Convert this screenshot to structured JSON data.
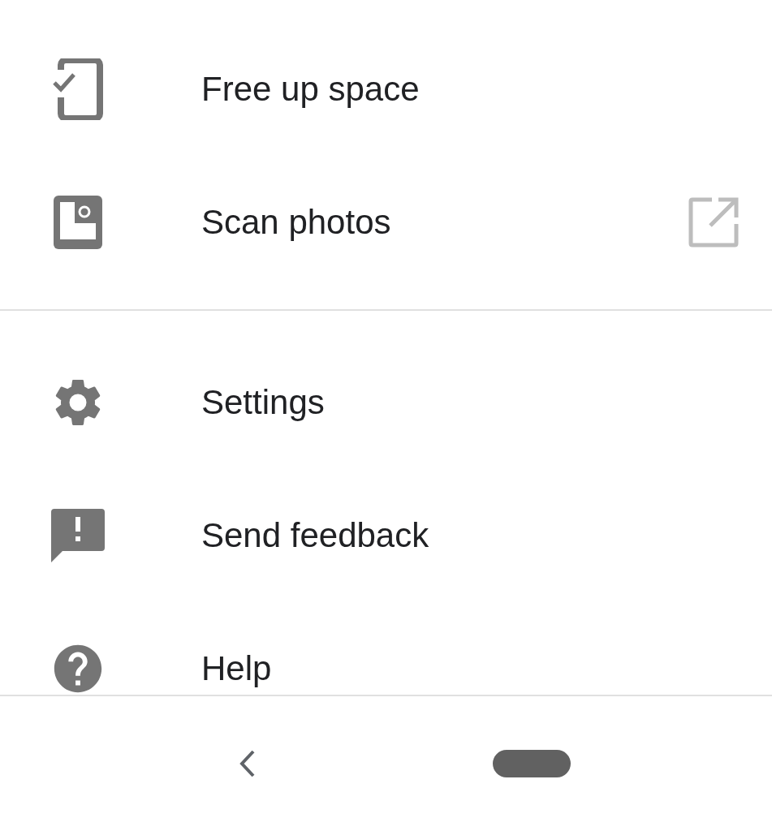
{
  "menu": {
    "sections": [
      {
        "items": [
          {
            "label": "Free up space",
            "external": false
          },
          {
            "label": "Scan photos",
            "external": true
          }
        ]
      },
      {
        "items": [
          {
            "label": "Settings",
            "external": false
          },
          {
            "label": "Send feedback",
            "external": false
          },
          {
            "label": "Help",
            "external": false
          }
        ]
      }
    ]
  },
  "nav_bar": {
    "buttons": [
      {
        "kind": "back"
      },
      {
        "kind": "home"
      }
    ]
  }
}
